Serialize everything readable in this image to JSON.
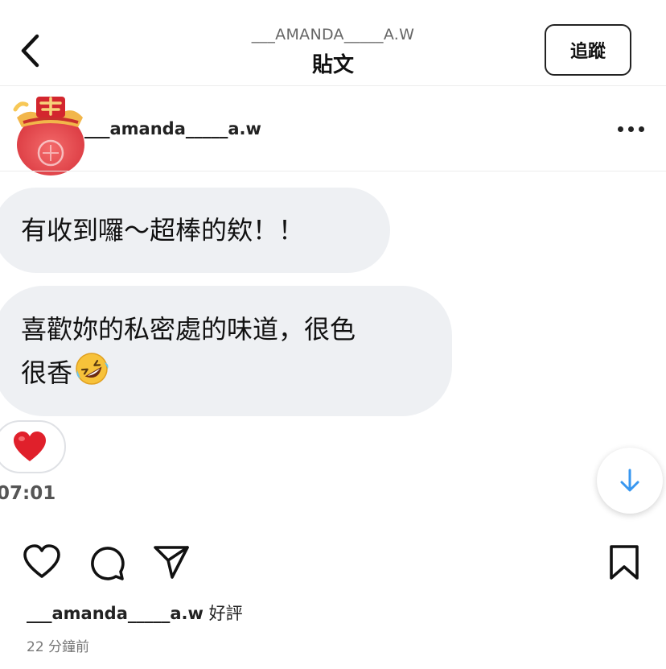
{
  "header": {
    "username": "___AMANDA_____A.W",
    "title": "貼文",
    "follow_label": "追蹤"
  },
  "post": {
    "author": "___amanda_____a.w",
    "messages": [
      "有收到囉～超棒的欸！！",
      "喜歡妳的私密處的味道，很色",
      "很香"
    ],
    "emoji_icon": "rolling-on-floor-laughing-emoji",
    "reaction_icon": "red-heart-emoji",
    "timestamp": "07:01"
  },
  "actions": {
    "icons": [
      "heart-icon",
      "comment-icon",
      "send-icon",
      "bookmark-icon"
    ]
  },
  "comment": {
    "user": "___amanda_____a.w",
    "text": "好評"
  },
  "time_ago": "22 分鐘前",
  "colors": {
    "bubble": "#eef0f3",
    "scroll_arrow": "#3897f0",
    "heart": "#e0202b"
  }
}
